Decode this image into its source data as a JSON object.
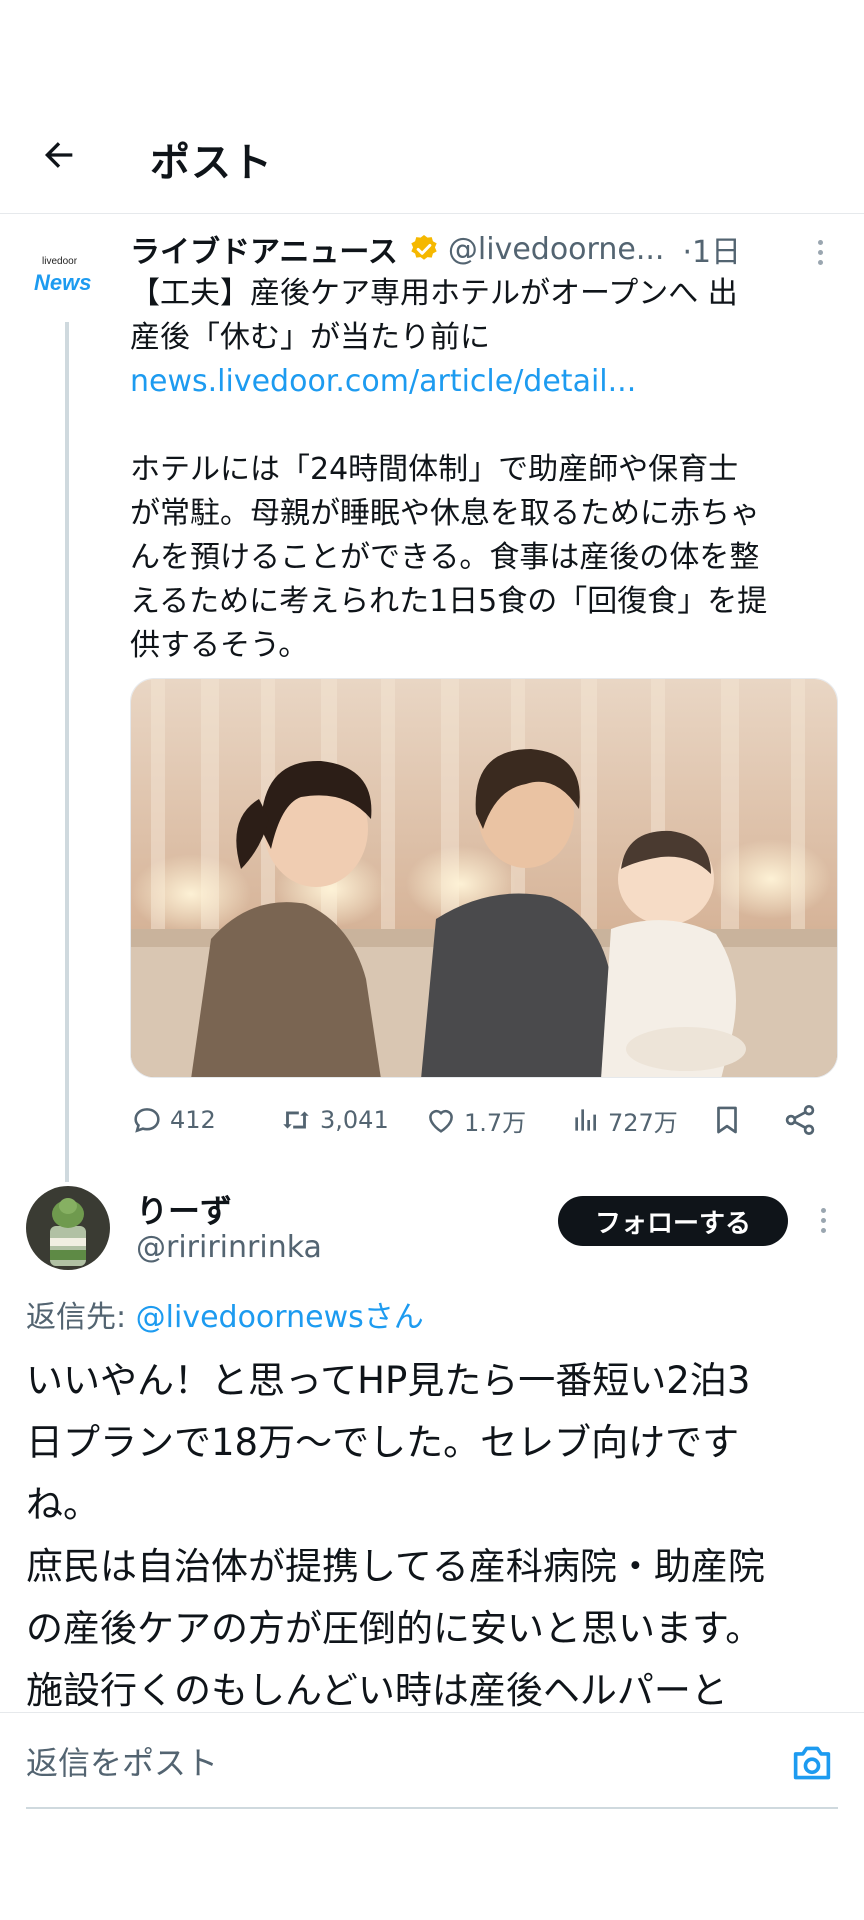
{
  "header": {
    "title": "ポスト"
  },
  "post": {
    "author_name": "ライブドアニュース",
    "handle": "@livedoorne...",
    "time": "·1日",
    "avatar_text_small": "livedoor",
    "avatar_text_big": "News",
    "text_line1": "【工夫】産後ケア専用ホテルがオープンへ 出",
    "text_line2": "産後「休む」が当たり前に",
    "link": "news.livedoor.com/article/detail...",
    "body_line1": "ホテルには「24時間体制」で助産師や保育士",
    "body_line2": "が常駐。母親が睡眠や休息を取るために赤ちゃ",
    "body_line3": "んを預けることができる。食事は産後の体を整",
    "body_line4": "えるために考えられた1日5食の「回復食」を提",
    "body_line5": "供するそう。",
    "stats": {
      "replies": "412",
      "reposts": "3,041",
      "likes": "1.7万",
      "views": "727万"
    }
  },
  "reply": {
    "author_name": "りーず",
    "handle": "@riririnrinka",
    "follow_label": "フォローする",
    "reply_to_prefix": "返信先: ",
    "reply_to_mention": "@livedoornewsさん",
    "line1": "いいやん！と思ってHP見たら一番短い2泊3",
    "line2": "日プランで18万〜でした。セレブ向けです",
    "line3": "ね。",
    "line4": "庶民は自治体が提携してる産科病院・助産院",
    "line5": "の産後ケアの方が圧倒的に安いと思います。",
    "line6": "施設行くのもしんどい時は産後ヘルパーと"
  },
  "composer": {
    "placeholder": "返信をポスト"
  },
  "colors": {
    "accent": "#1d9bf0",
    "verified": "#f5b800",
    "muted": "#536471"
  },
  "icons": [
    "back-arrow-icon",
    "verified-badge-icon",
    "more-icon",
    "reply-icon",
    "repost-icon",
    "like-icon",
    "views-icon",
    "bookmark-icon",
    "share-icon",
    "camera-icon"
  ]
}
